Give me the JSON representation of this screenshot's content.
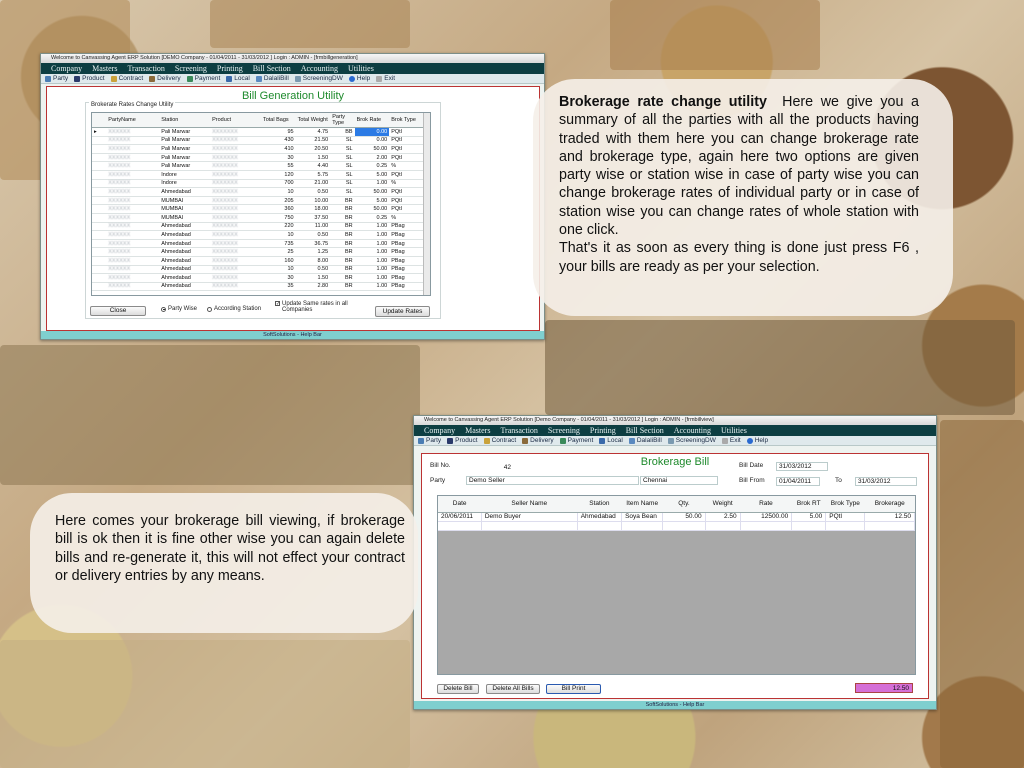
{
  "win1": {
    "title": "Welcome to Canvassing Agent ERP Solution [DEMO Company - 01/04/2011 - 31/03/2012 ] Login : ADMIN - [frmbillgeneration]",
    "menu": [
      "Company",
      "Masters",
      "Transaction",
      "Screening",
      "Printing",
      "Bill Section",
      "Accounting",
      "Utilities"
    ],
    "toolbar": [
      "Party",
      "Product",
      "Contract",
      "Delivery",
      "Payment",
      "Local",
      "DalaliBill",
      "ScreeningDW",
      "Help",
      "Exit"
    ],
    "heading": "Bill Generation Utility",
    "group_label": "Brokerate Rates Change Utility",
    "columns": [
      "",
      "PartyName",
      "Station",
      "Product",
      "Total Bags",
      "Total Weight",
      "Party Type",
      "Brok Rate",
      "Brok Type"
    ],
    "rows": [
      [
        "▸",
        "XXXXXX",
        "Pali Marwar",
        "XXXXXXX",
        "95",
        "4.75",
        "BB",
        "0.00",
        "PQtl"
      ],
      [
        "",
        "XXXXXX",
        "Pali Marwar",
        "XXXXXXX",
        "430",
        "21.50",
        "SL",
        "0.00",
        "PQtl"
      ],
      [
        "",
        "XXXXXX",
        "Pali Marwar",
        "XXXXXXX",
        "410",
        "20.50",
        "SL",
        "50.00",
        "PQtl"
      ],
      [
        "",
        "XXXXXX",
        "Pali Marwar",
        "XXXXXXX",
        "30",
        "1.50",
        "SL",
        "2.00",
        "PQtl"
      ],
      [
        "",
        "XXXXXX",
        "Pali Marwar",
        "XXXXXXX",
        "55",
        "4.40",
        "SL",
        "0.25",
        "%"
      ],
      [
        "",
        "XXXXXX",
        "Indore",
        "XXXXXXX",
        "120",
        "5.75",
        "SL",
        "5.00",
        "PQtl"
      ],
      [
        "",
        "XXXXXX",
        "Indore",
        "XXXXXXX",
        "700",
        "21.00",
        "SL",
        "1.00",
        "%"
      ],
      [
        "",
        "XXXXXX",
        "Ahmedabad",
        "XXXXXXX",
        "10",
        "0.50",
        "SL",
        "50.00",
        "PQtl"
      ],
      [
        "",
        "XXXXXX",
        "MUMBAI",
        "XXXXXXX",
        "205",
        "10.00",
        "BR",
        "5.00",
        "PQtl"
      ],
      [
        "",
        "XXXXXX",
        "MUMBAI",
        "XXXXXXX",
        "360",
        "18.00",
        "BR",
        "50.00",
        "PQtl"
      ],
      [
        "",
        "XXXXXX",
        "MUMBAI",
        "XXXXXXX",
        "750",
        "37.50",
        "BR",
        "0.25",
        "%"
      ],
      [
        "",
        "XXXXXX",
        "Ahmedabad",
        "XXXXXXX",
        "220",
        "11.00",
        "BR",
        "1.00",
        "PBag"
      ],
      [
        "",
        "XXXXXX",
        "Ahmedabad",
        "XXXXXXX",
        "10",
        "0.50",
        "BR",
        "1.00",
        "PBag"
      ],
      [
        "",
        "XXXXXX",
        "Ahmedabad",
        "XXXXXXX",
        "735",
        "36.75",
        "BR",
        "1.00",
        "PBag"
      ],
      [
        "",
        "XXXXXX",
        "Ahmedabad",
        "XXXXXXX",
        "25",
        "1.25",
        "BR",
        "1.00",
        "PBag"
      ],
      [
        "",
        "XXXXXX",
        "Ahmedabad",
        "XXXXXXX",
        "160",
        "8.00",
        "BR",
        "1.00",
        "PBag"
      ],
      [
        "",
        "XXXXXX",
        "Ahmedabad",
        "XXXXXXX",
        "10",
        "0.50",
        "BR",
        "1.00",
        "PBag"
      ],
      [
        "",
        "XXXXXX",
        "Ahmedabad",
        "XXXXXXX",
        "30",
        "1.50",
        "BR",
        "1.00",
        "PBag"
      ],
      [
        "",
        "XXXXXX",
        "Ahmedabad",
        "XXXXXXX",
        "35",
        "2.80",
        "BR",
        "1.00",
        "PBag"
      ]
    ],
    "close_label": "Close",
    "radio_party": "Party Wise",
    "radio_station": "According Station",
    "update_same": "Update Same rates in all Companies",
    "update_button": "Update Rates",
    "help_bar": "SoftSolutions - Help Bar"
  },
  "win2": {
    "title": "Welcome to Canvassing Agent ERP Solution [Demo Company - 01/04/2011 - 31/03/2012 ] Login : ADMIN - [frmbillview]",
    "menu": [
      "Company",
      "Masters",
      "Transaction",
      "Screening",
      "Printing",
      "Bill Section",
      "Accounting",
      "Utilities"
    ],
    "toolbar": [
      "Party",
      "Product",
      "Contract",
      "Delivery",
      "Payment",
      "Local",
      "DalaliBill",
      "ScreeningDW",
      "Exit",
      "Help"
    ],
    "heading": "Brokerage Bill",
    "bill_no_label": "Bill No.",
    "bill_no": "42",
    "bill_date_label": "Bill Date",
    "bill_date": "31/03/2012",
    "party_label": "Party",
    "party_name": "Demo Seller",
    "party_city": "Chennai",
    "bill_from_label": "Bill From",
    "bill_from": "01/04/2011",
    "to_label": "To",
    "bill_to": "31/03/2012",
    "columns": [
      "Date",
      "Seller Name",
      "Station",
      "Item Name",
      "Qty.",
      "Weight",
      "Rate",
      "Brok RT",
      "Brok Type",
      "Brokerage"
    ],
    "rows": [
      [
        "20/06/2011",
        "Demo Buyer",
        "Ahmedabad",
        "Soya Bean",
        "50.00",
        "2.50",
        "12500.00",
        "5.00",
        "PQtl",
        "12.50"
      ]
    ],
    "delete_bill": "Delete Bill",
    "delete_all": "Delete All Bills",
    "bill_print": "Bill Print",
    "total": "12.50",
    "help_bar": "SoftSolutions - Help Bar"
  },
  "bubble1": {
    "heading": "Brokerage rate change utility",
    "body": "Here we give you a summary of all the parties with all the products having traded with them here you can change brokerage rate and brokerage type, again here two options are given party wise or station wise in case of party wise you can change brokerage rates of individual party or in case of station wise you can change rates of whole station with one click.",
    "body2": "That's it as soon as every thing is done just press F6 , your bills are ready as per your selection."
  },
  "bubble2": {
    "body": "Here comes your brokerage bill viewing, if brokerage bill is ok then it is fine other wise you can again delete bills and re-generate it, this will not effect your contract or delivery entries by any means."
  }
}
